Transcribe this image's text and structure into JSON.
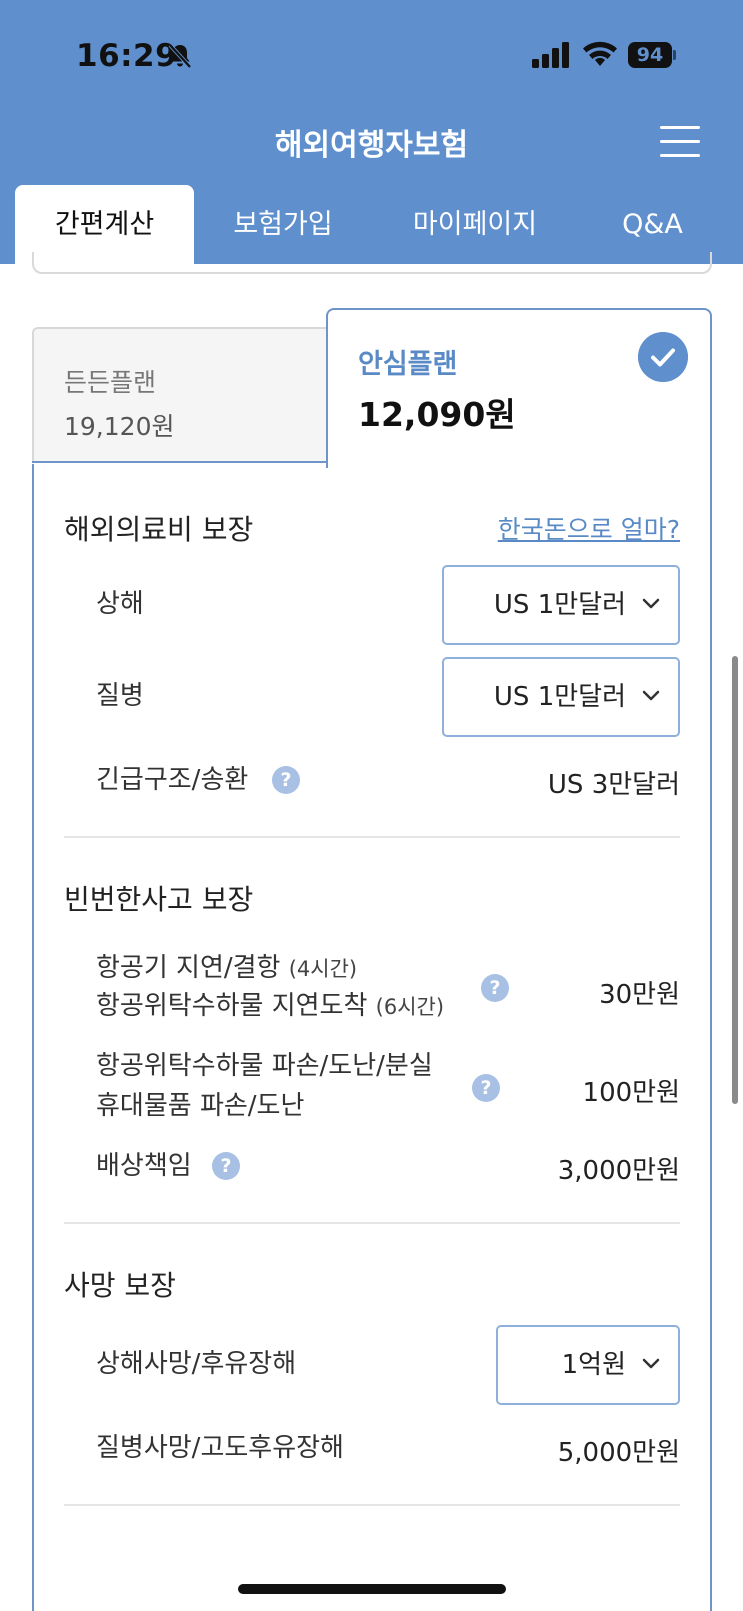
{
  "status_bar": {
    "time": "16:29",
    "battery": "94"
  },
  "app": {
    "title": "해외여행자보험"
  },
  "tabs": [
    {
      "label": "간편계산",
      "active": true
    },
    {
      "label": "보험가입",
      "active": false
    },
    {
      "label": "마이페이지",
      "active": false
    },
    {
      "label": "Q&A",
      "active": false
    }
  ],
  "plans": [
    {
      "name": "든든플랜",
      "price": "19,120원",
      "selected": false
    },
    {
      "name": "안심플랜",
      "price": "12,090원",
      "selected": true
    }
  ],
  "sections": {
    "medical": {
      "title": "해외의료비 보장",
      "link": "한국돈으로 얼마?",
      "rows": {
        "injury": {
          "label": "상해",
          "value": "US 1만달러"
        },
        "disease": {
          "label": "질병",
          "value": "US 1만달러"
        },
        "rescue": {
          "label": "긴급구조/송환",
          "value": "US 3만달러"
        }
      }
    },
    "frequent": {
      "title": "빈번한사고 보장",
      "rows": {
        "flight": {
          "line1": "항공기 지연/결항",
          "line1_note": "(4시간)",
          "line2": "항공위탁수하물 지연도착",
          "line2_note": "(6시간)",
          "value": "30만원"
        },
        "baggage": {
          "line1": "항공위탁수하물 파손/도난/분실",
          "line2": "휴대물품 파손/도난",
          "value": "100만원"
        },
        "liability": {
          "label": "배상책임",
          "value": "3,000만원"
        }
      }
    },
    "death": {
      "title": "사망 보장",
      "rows": {
        "injury_death": {
          "label": "상해사망/후유장해",
          "value": "1억원"
        },
        "disease_death": {
          "label": "질병사망/고도후유장해",
          "value": "5,000만원"
        }
      }
    }
  },
  "help_symbol": "?",
  "colors": {
    "brand": "#5f8fcd",
    "accent_text": "#5a8ac6",
    "help_icon": "#a7c0e3"
  }
}
